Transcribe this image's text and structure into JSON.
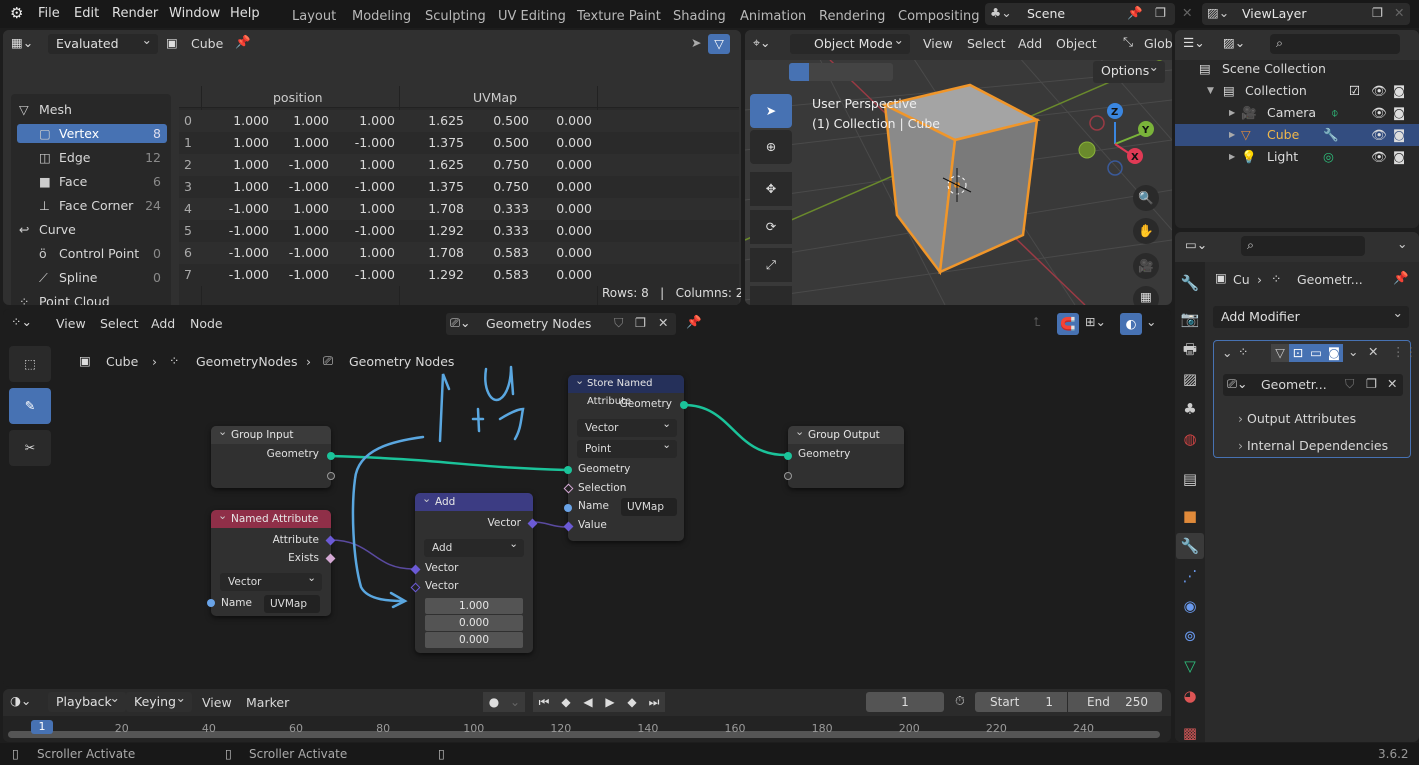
{
  "top_menu": [
    "File",
    "Edit",
    "Render",
    "Window",
    "Help"
  ],
  "workspaces": [
    "Layout",
    "Modeling",
    "Sculpting",
    "UV Editing",
    "Texture Paint",
    "Shading",
    "Animation",
    "Rendering",
    "Compositing"
  ],
  "scene": "Scene",
  "view_layer": "ViewLayer",
  "spreadsheet": {
    "mode": "Evaluated",
    "object": "Cube",
    "domains": [
      {
        "label": "Mesh",
        "count": "",
        "level": 0,
        "icon": "mesh-icon"
      },
      {
        "label": "Vertex",
        "count": "8",
        "level": 1,
        "selected": true,
        "icon": "vertex-icon"
      },
      {
        "label": "Edge",
        "count": "12",
        "level": 1,
        "icon": "edge-icon"
      },
      {
        "label": "Face",
        "count": "6",
        "level": 1,
        "icon": "face-icon"
      },
      {
        "label": "Face Corner",
        "count": "24",
        "level": 1,
        "icon": "face-corner-icon"
      },
      {
        "label": "Curve",
        "count": "",
        "level": 0,
        "icon": "curve-icon"
      },
      {
        "label": "Control Point",
        "count": "0",
        "level": 1,
        "icon": "control-point-icon"
      },
      {
        "label": "Spline",
        "count": "0",
        "level": 1,
        "icon": "spline-icon"
      },
      {
        "label": "Point Cloud",
        "count": "",
        "level": 0,
        "icon": "point-cloud-icon"
      }
    ],
    "columns": [
      "position",
      "UVMap"
    ],
    "rows": [
      [
        "0",
        "1.000",
        "1.000",
        "1.000",
        "1.625",
        "0.500",
        "0.000"
      ],
      [
        "1",
        "1.000",
        "1.000",
        "-1.000",
        "1.375",
        "0.500",
        "0.000"
      ],
      [
        "2",
        "1.000",
        "-1.000",
        "1.000",
        "1.625",
        "0.750",
        "0.000"
      ],
      [
        "3",
        "1.000",
        "-1.000",
        "-1.000",
        "1.375",
        "0.750",
        "0.000"
      ],
      [
        "4",
        "-1.000",
        "1.000",
        "1.000",
        "1.708",
        "0.333",
        "0.000"
      ],
      [
        "5",
        "-1.000",
        "1.000",
        "-1.000",
        "1.292",
        "0.333",
        "0.000"
      ],
      [
        "6",
        "-1.000",
        "-1.000",
        "1.000",
        "1.708",
        "0.583",
        "0.000"
      ],
      [
        "7",
        "-1.000",
        "-1.000",
        "-1.000",
        "1.292",
        "0.583",
        "0.000"
      ]
    ],
    "footer": "Rows: 8   |   Columns: 2"
  },
  "viewport": {
    "mode": "Object Mode",
    "menus": [
      "View",
      "Select",
      "Add",
      "Object"
    ],
    "orientation": "Glob",
    "options": "Options",
    "overlay_line1": "User Perspective",
    "overlay_line2": "(1) Collection | Cube",
    "gizmo": {
      "x": "X",
      "y": "Y",
      "z": "Z"
    }
  },
  "outliner": {
    "root": "Scene Collection",
    "collection": "Collection",
    "items": [
      {
        "label": "Camera",
        "selected": false
      },
      {
        "label": "Cube",
        "selected": true
      },
      {
        "label": "Light",
        "selected": false
      }
    ]
  },
  "properties": {
    "breadcrumb_obj": "Cu",
    "breadcrumb_mod": "Geometr...",
    "add_modifier": "Add Modifier",
    "node_group": "Geometr...",
    "panels": [
      "Output Attributes",
      "Internal Dependencies"
    ]
  },
  "node_editor": {
    "menus": [
      "View",
      "Select",
      "Add",
      "Node"
    ],
    "tree_name": "Geometry Nodes",
    "breadcrumb": [
      "Cube",
      "GeometryNodes",
      "Geometry Nodes"
    ],
    "nodes": {
      "group_input": {
        "title": "Group Input",
        "out": "Geometry"
      },
      "named_attr": {
        "title": "Named Attribute",
        "out1": "Attribute",
        "out2": "Exists",
        "type": "Vector",
        "name_label": "Name",
        "name_val": "UVMap"
      },
      "add": {
        "title": "Add",
        "out": "Vector",
        "op": "Add",
        "in1": "Vector",
        "in2": "Vector",
        "vals": [
          "1.000",
          "0.000",
          "0.000"
        ]
      },
      "store": {
        "title": "Store Named Attribute",
        "out": "Geometry",
        "type": "Vector",
        "domain": "Point",
        "in_geo": "Geometry",
        "in_sel": "Selection",
        "name_label": "Name",
        "name_val": "UVMap",
        "in_val": "Value"
      },
      "group_output": {
        "title": "Group Output",
        "in": "Geometry"
      }
    },
    "annotation_text": "u + 1"
  },
  "timeline": {
    "menus": [
      "Playback",
      "Keying",
      "View",
      "Marker"
    ],
    "current_frame": "1",
    "start_label": "Start",
    "start": "1",
    "end_label": "End",
    "end": "250",
    "ticks": [
      "1",
      "20",
      "40",
      "60",
      "80",
      "100",
      "120",
      "140",
      "160",
      "180",
      "200",
      "220",
      "240"
    ]
  },
  "status": {
    "left": "Scroller Activate",
    "mid": "Scroller Activate",
    "version": "3.6.2"
  }
}
